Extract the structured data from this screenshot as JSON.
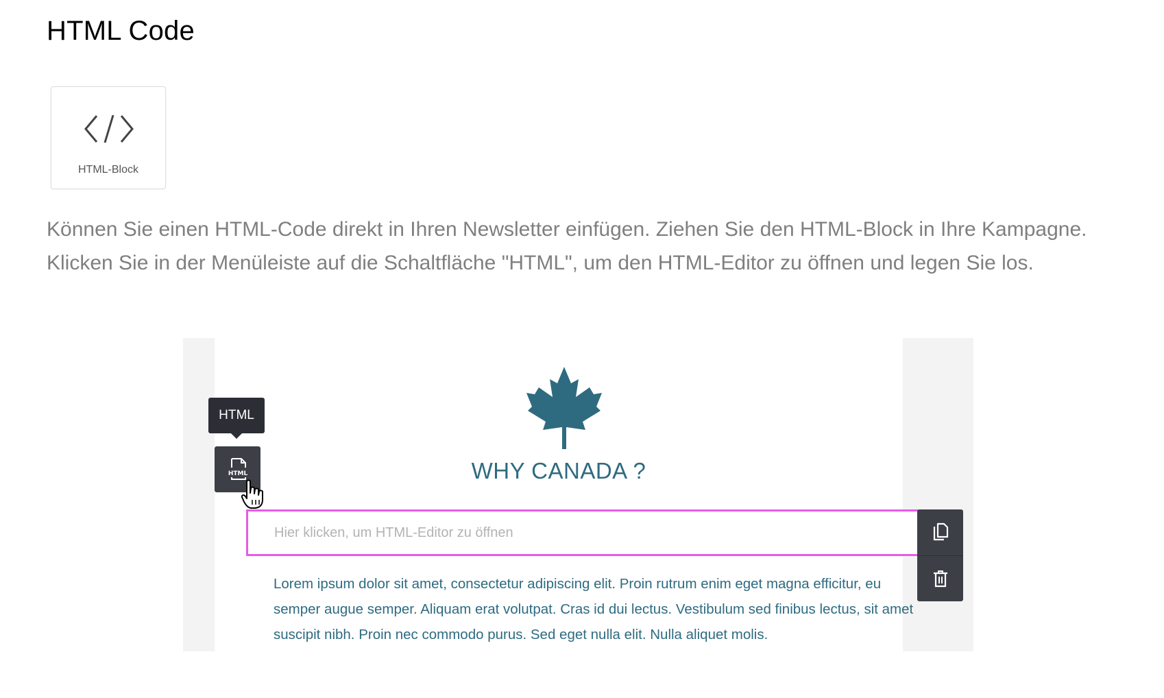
{
  "page": {
    "title": "HTML Code",
    "description": "Können Sie einen HTML-Code direkt in Ihren Newsletter einfügen. Ziehen Sie den HTML-Block in Ihre Kampagne. Klicken Sie in der Menüleiste auf die Schaltfläche \"HTML\", um den HTML-Editor zu öffnen und legen Sie los."
  },
  "block_card": {
    "label": "HTML-Block",
    "icon": "code-icon"
  },
  "editor": {
    "headline": "WHY CANADA ?",
    "logo_icon": "maple-leaf-icon",
    "tooltip": "HTML",
    "html_button_icon": "html-file-icon",
    "placeholder": "Hier klicken, um HTML-Editor zu öffnen",
    "body_text": "Lorem ipsum dolor sit amet, consectetur adipiscing elit. Proin rutrum enim eget magna efficitur, eu semper augue semper. Aliquam erat volutpat. Cras id dui lectus. Vestibulum sed finibus lectus, sit amet suscipit nibh. Proin nec commodo purus. Sed eget nulla elit. Nulla aliquet molis.",
    "toolbar": [
      {
        "icon": "copy-icon"
      },
      {
        "icon": "trash-icon"
      }
    ]
  },
  "colors": {
    "accent_teal": "#2e6b80",
    "selection_border": "#e75be7",
    "toolbar_dark": "#3d3f47"
  }
}
